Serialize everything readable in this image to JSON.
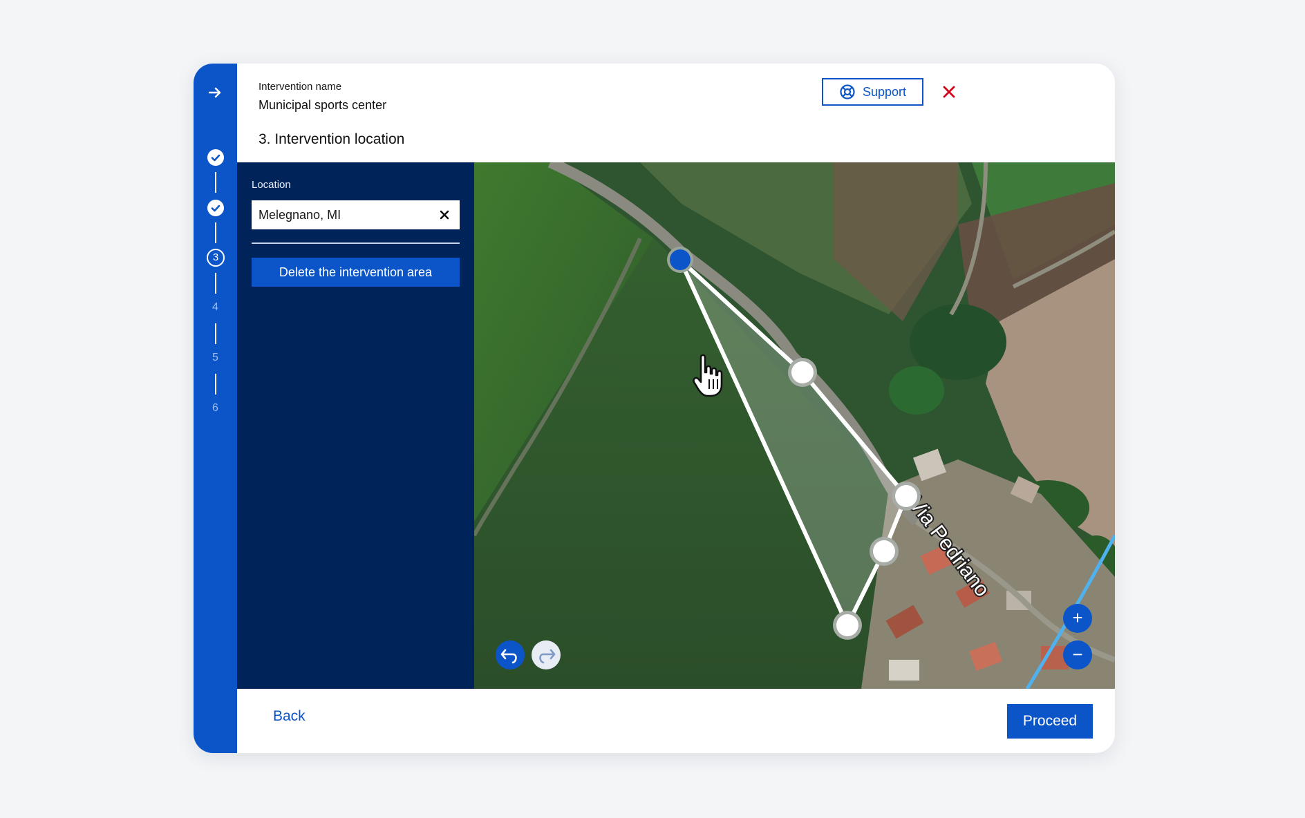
{
  "header": {
    "intervention_label": "Intervention name",
    "intervention_name": "Municipal sports center",
    "step_title": "3. Intervention location",
    "support_label": "Support"
  },
  "stepper": {
    "current_step": "3",
    "upcoming_steps": [
      "4",
      "5",
      "6"
    ]
  },
  "sidebar": {
    "location_label": "Location",
    "location_value": "Melegnano, MI",
    "delete_label": "Delete the intervention area"
  },
  "map": {
    "street_label": "Via Pedriano",
    "zoom_in_symbol": "+",
    "zoom_out_symbol": "−"
  },
  "footer": {
    "back_label": "Back",
    "proceed_label": "Proceed"
  },
  "colors": {
    "primary": "#0b55c8",
    "panel": "#002459",
    "close": "#d0021b"
  }
}
